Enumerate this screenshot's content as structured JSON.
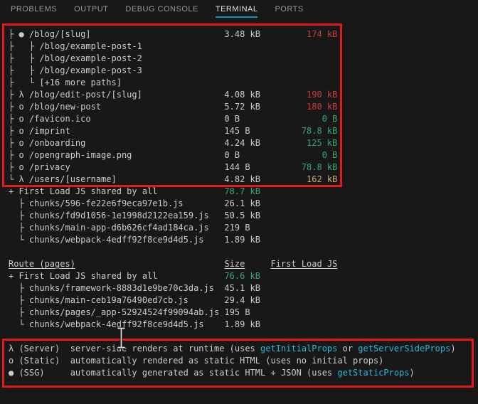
{
  "colors": {
    "bg": "#181818",
    "fg": "#cccccc",
    "red": "#cd3a3a",
    "green": "#35a877",
    "yellow": "#c5b070",
    "cyan": "#29b8db",
    "tab_inactive": "#9a9a9a",
    "tab_active": "#e2e2e2",
    "tab_underline": "#1b8ac4",
    "annotation": "#e61717"
  },
  "tabbar": {
    "tabs": [
      {
        "label": "PROBLEMS",
        "active": false
      },
      {
        "label": "OUTPUT",
        "active": false
      },
      {
        "label": "DEBUG CONSOLE",
        "active": false
      },
      {
        "label": "TERMINAL",
        "active": true
      },
      {
        "label": "PORTS",
        "active": false
      }
    ]
  },
  "terminal": {
    "lines": [
      [
        {
          "t": "├ ● /blog/[slug]                          3.48 kB         "
        },
        {
          "t": "174 kB",
          "c": "red"
        }
      ],
      [
        {
          "t": "├   ├ /blog/example-post-1"
        }
      ],
      [
        {
          "t": "├   ├ /blog/example-post-2"
        }
      ],
      [
        {
          "t": "├   ├ /blog/example-post-3"
        }
      ],
      [
        {
          "t": "├   └ [+16 more paths]"
        }
      ],
      [
        {
          "t": "├ λ /blog/edit-post/[slug]                4.08 kB         "
        },
        {
          "t": "190 kB",
          "c": "red"
        }
      ],
      [
        {
          "t": "├ o /blog/new-post                        5.72 kB         "
        },
        {
          "t": "180 kB",
          "c": "red"
        }
      ],
      [
        {
          "t": "├ o /favicon.ico                          0 B                "
        },
        {
          "t": "0 B",
          "c": "green"
        }
      ],
      [
        {
          "t": "├ o /imprint                              145 B          "
        },
        {
          "t": "78.8 kB",
          "c": "green"
        }
      ],
      [
        {
          "t": "├ o /onboarding                           4.24 kB         "
        },
        {
          "t": "125 kB",
          "c": "green"
        }
      ],
      [
        {
          "t": "├ o /opengraph-image.png                  0 B                "
        },
        {
          "t": "0 B",
          "c": "green"
        }
      ],
      [
        {
          "t": "├ o /privacy                              144 B          "
        },
        {
          "t": "78.8 kB",
          "c": "green"
        }
      ],
      [
        {
          "t": "└ λ /users/[username]                     4.82 kB         "
        },
        {
          "t": "162 kB",
          "c": "yellow"
        }
      ],
      [
        {
          "t": "+ First Load JS shared by all             "
        },
        {
          "t": "78.7 kB",
          "c": "green"
        }
      ],
      [
        {
          "t": "  ├ chunks/596-fe22e6f9eca97e1b.js        26.1 kB"
        }
      ],
      [
        {
          "t": "  ├ chunks/fd9d1056-1e1998d2122ea159.js   50.5 kB"
        }
      ],
      [
        {
          "t": "  ├ chunks/main-app-d6b626cf4ad184ca.js   219 B"
        }
      ],
      [
        {
          "t": "  └ chunks/webpack-4edff92f8ce9d4d5.js    1.89 kB"
        }
      ],
      [
        {
          "t": ""
        }
      ],
      [
        {
          "t": "Route (pages)",
          "u": true
        },
        {
          "t": "                             "
        },
        {
          "t": "Size",
          "u": true
        },
        {
          "t": "     "
        },
        {
          "t": "First Load JS",
          "u": true
        }
      ],
      [
        {
          "t": "+ First Load JS shared by all             "
        },
        {
          "t": "76.6 kB",
          "c": "green"
        }
      ],
      [
        {
          "t": "  ├ chunks/framework-8883d1e9be70c3da.js  45.1 kB"
        }
      ],
      [
        {
          "t": "  ├ chunks/main-ceb19a76490ed7cb.js       29.4 kB"
        }
      ],
      [
        {
          "t": "  ├ chunks/pages/_app-52924524f99094ab.js 195 B"
        }
      ],
      [
        {
          "t": "  └ chunks/webpack-4edff92f8ce9d4d5.js    1.89 kB"
        }
      ],
      [
        {
          "t": ""
        }
      ],
      [
        {
          "t": "λ (Server)  server-side renders at runtime (uses "
        },
        {
          "t": "getInitialProps",
          "c": "cyan"
        },
        {
          "t": " or "
        },
        {
          "t": "getServerSideProps",
          "c": "cyan"
        },
        {
          "t": ")"
        }
      ],
      [
        {
          "t": "o (Static)  automatically rendered as static HTML (uses no initial props)"
        }
      ],
      [
        {
          "t": "● (SSG)     automatically generated as static HTML + JSON (uses "
        },
        {
          "t": "getStaticProps",
          "c": "cyan"
        },
        {
          "t": ")"
        }
      ]
    ]
  },
  "annotations": {
    "boxes": [
      {
        "name": "routes-highlight"
      },
      {
        "name": "legend-highlight"
      }
    ]
  },
  "cursor": {
    "type": "text-ibeam"
  }
}
